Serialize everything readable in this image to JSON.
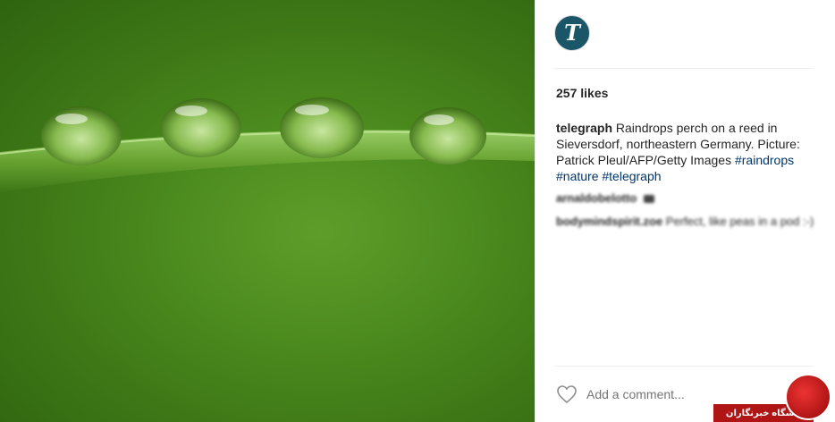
{
  "post": {
    "likes": "257 likes",
    "caption": {
      "username": "telegraph",
      "text": "Raindrops perch on a reed in Sieversdorf, northeastern Germany. Picture: Patrick Pleul/AFP/Getty Images",
      "hashtags": [
        "#raindrops",
        "#nature",
        "#telegraph"
      ]
    },
    "comments": [
      {
        "username": "arnaldobelotto",
        "text": ""
      },
      {
        "username": "bodymindspirit.zoe",
        "text": "Perfect, like peas in a pod :-)"
      }
    ],
    "add_comment_placeholder": "Add a comment..."
  },
  "account": {
    "avatar_letter": "T"
  },
  "watermark": {
    "text": "باشگاه خبرنگاران"
  },
  "colors": {
    "hashtag": "#003569",
    "avatar_bg": "#1b5668",
    "photo_green": "#4b8a1e",
    "watermark_red": "#b01515"
  },
  "icons": [
    "heart-icon",
    "camera-icon"
  ]
}
